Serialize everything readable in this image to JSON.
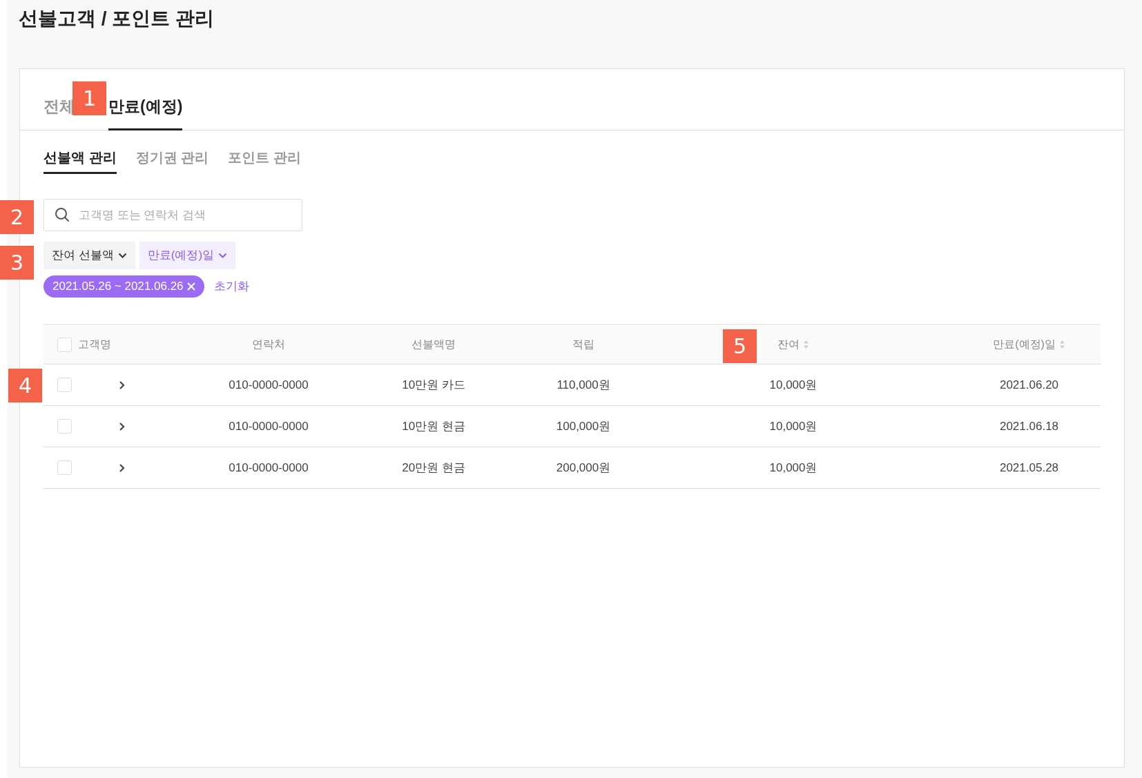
{
  "page_title": "선불고객 / 포인트 관리",
  "tabs": [
    {
      "label": "전체",
      "selected": false
    },
    {
      "label": "만료(예정)",
      "selected": true
    }
  ],
  "sub_tabs": [
    {
      "label": "선불액 관리",
      "selected": true
    },
    {
      "label": "정기권 관리",
      "selected": false
    },
    {
      "label": "포인트 관리",
      "selected": false
    }
  ],
  "search": {
    "placeholder": "고객명 또는 연락처 검색"
  },
  "filters": [
    {
      "label": "잔여 선불액",
      "active": false
    },
    {
      "label": "만료(예정)일",
      "active": true
    }
  ],
  "applied_filter": {
    "label": "2021.05.26 ~ 2021.06.26"
  },
  "reset_link": "초기화",
  "table": {
    "select_all_checked": false,
    "columns": [
      {
        "label": "고객명",
        "sortable": false
      },
      {
        "label": "연락처",
        "sortable": false
      },
      {
        "label": "선불액명",
        "sortable": false
      },
      {
        "label": "적립",
        "sortable": false
      },
      {
        "label": "잔여",
        "sortable": true
      },
      {
        "label": "만료(예정)일",
        "sortable": true
      }
    ],
    "rows": [
      {
        "checked": false,
        "cells": [
          "",
          "010-0000-0000",
          "10만원 카드",
          "110,000원",
          "10,000원",
          "2021.06.20"
        ]
      },
      {
        "checked": false,
        "cells": [
          "",
          "010-0000-0000",
          "10만원 현금",
          "100,000원",
          "10,000원",
          "2021.06.18"
        ]
      },
      {
        "checked": false,
        "cells": [
          "",
          "010-0000-0000",
          "20만원 현금",
          "200,000원",
          "10,000원",
          "2021.05.28"
        ]
      }
    ]
  },
  "callouts": [
    {
      "label": "1"
    },
    {
      "label": "2"
    },
    {
      "label": "3"
    },
    {
      "label": "4"
    },
    {
      "label": "5"
    }
  ]
}
